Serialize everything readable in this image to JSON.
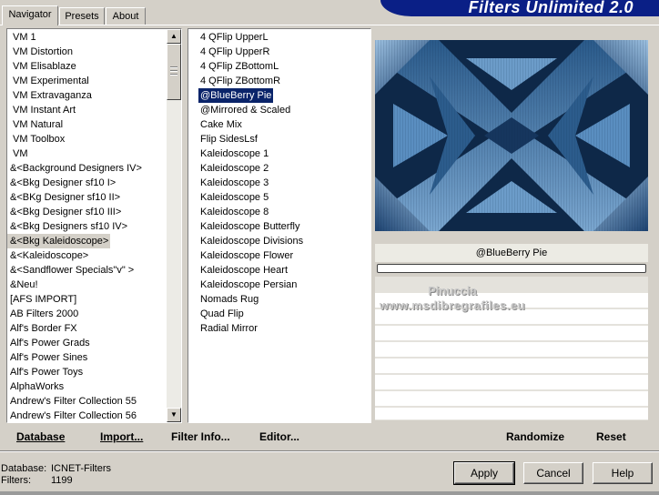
{
  "app": {
    "title": "Filters Unlimited 2.0"
  },
  "tabs": [
    {
      "label": "Navigator",
      "active": true
    },
    {
      "label": "Presets",
      "active": false
    },
    {
      "label": "About",
      "active": false
    }
  ],
  "categories": {
    "selected": "&<Bkg Kaleidoscope>",
    "items": [
      "VM 1",
      "VM Distortion",
      "VM Elisablaze",
      "VM Experimental",
      "VM Extravaganza",
      "VM Instant Art",
      "VM Natural",
      "VM Toolbox",
      "VM",
      "&<Background Designers IV>",
      "&<Bkg Designer sf10 I>",
      "&<BKg Designer sf10 II>",
      "&<Bkg Designer sf10 III>",
      "&<Bkg Designers sf10 IV>",
      "&<Bkg Kaleidoscope>",
      "&<Kaleidoscope>",
      "&<Sandflower Specials\"v\" >",
      "&Neu!",
      "[AFS IMPORT]",
      "AB Filters 2000",
      "Alf's Border FX",
      "Alf's Power Grads",
      "Alf's Power Sines",
      "Alf's Power Toys",
      "AlphaWorks",
      "Andrew's Filter Collection 55",
      "Andrew's Filter Collection 56"
    ]
  },
  "filters": {
    "selected": "@BlueBerry Pie",
    "items": [
      "4 QFlip UpperL",
      "4 QFlip UpperR",
      "4 QFlip ZBottomL",
      "4 QFlip ZBottomR",
      "@BlueBerry Pie",
      "@Mirrored & Scaled",
      "Cake Mix",
      "Flip SidesLsf",
      "Kaleidoscope 1",
      "Kaleidoscope 2",
      "Kaleidoscope 3",
      "Kaleidoscope 5",
      "Kaleidoscope 8",
      "Kaleidoscope Butterfly",
      "Kaleidoscope Divisions",
      "Kaleidoscope Flower",
      "Kaleidoscope Heart",
      "Kaleidoscope Persian",
      "Nomads Rug",
      "Quad Flip",
      "Radial Mirror"
    ]
  },
  "preview": {
    "filter_name": "@BlueBerry Pie",
    "watermark_line1": "Pinuccia",
    "watermark_line2": "www.msdibregrafiles.eu",
    "colors": {
      "dark": "#0e2848",
      "mid": "#3a6e9e",
      "light": "#9cc0e0"
    }
  },
  "actions": {
    "database": "Database",
    "import": "Import...",
    "filter_info": "Filter Info...",
    "editor": "Editor...",
    "randomize": "Randomize",
    "reset": "Reset"
  },
  "status": {
    "database_label": "Database:",
    "database_value": "ICNET-Filters",
    "filters_label": "Filters:",
    "filters_value": "1199"
  },
  "buttons": {
    "apply": "Apply",
    "cancel": "Cancel",
    "help": "Help"
  }
}
